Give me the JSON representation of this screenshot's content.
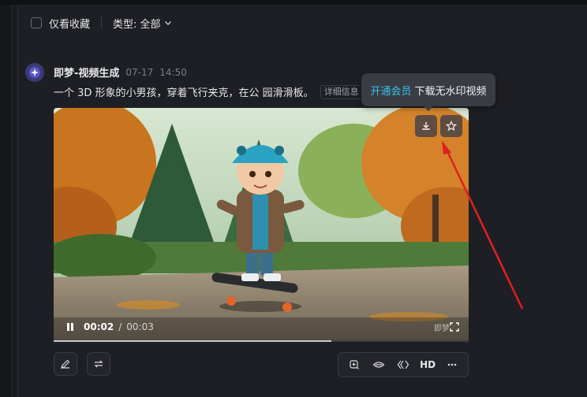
{
  "toolbar": {
    "favorites_only_label": "仅看收藏",
    "type_filter_label": "类型: 全部"
  },
  "item": {
    "author": "即梦-视频生成",
    "date": "07-17",
    "time": "14:50",
    "prompt": "一个 3D 形象的小男孩，穿着飞行夹克，在公 园滑滑板。",
    "detail_button": "详细信息"
  },
  "tooltip": {
    "vip_link": "开通会员",
    "text": "下载无水印视频"
  },
  "video": {
    "current_time": "00:02",
    "time_separator": "/",
    "duration": "00:03",
    "watermark": "即梦",
    "progress_fraction": 0.67
  },
  "actions": {
    "hd_label": "HD"
  },
  "icons": {
    "checkbox": "checkbox-icon",
    "chevron": "chevron-down-icon",
    "avatar": "jimeng-logo-icon",
    "download": "download-icon",
    "favorite": "star-icon",
    "pause": "pause-icon",
    "fullscreen": "fullscreen-icon",
    "edit": "edit-icon",
    "regenerate": "regenerate-icon",
    "extend": "extend-video-icon",
    "lipsync": "lip-sync-icon",
    "redo": "remix-icon",
    "more": "more-icon"
  },
  "colors": {
    "accent_link": "#36c3e6",
    "arrow_annotation": "#e0201e",
    "panel_bg": "#1e1f24"
  }
}
